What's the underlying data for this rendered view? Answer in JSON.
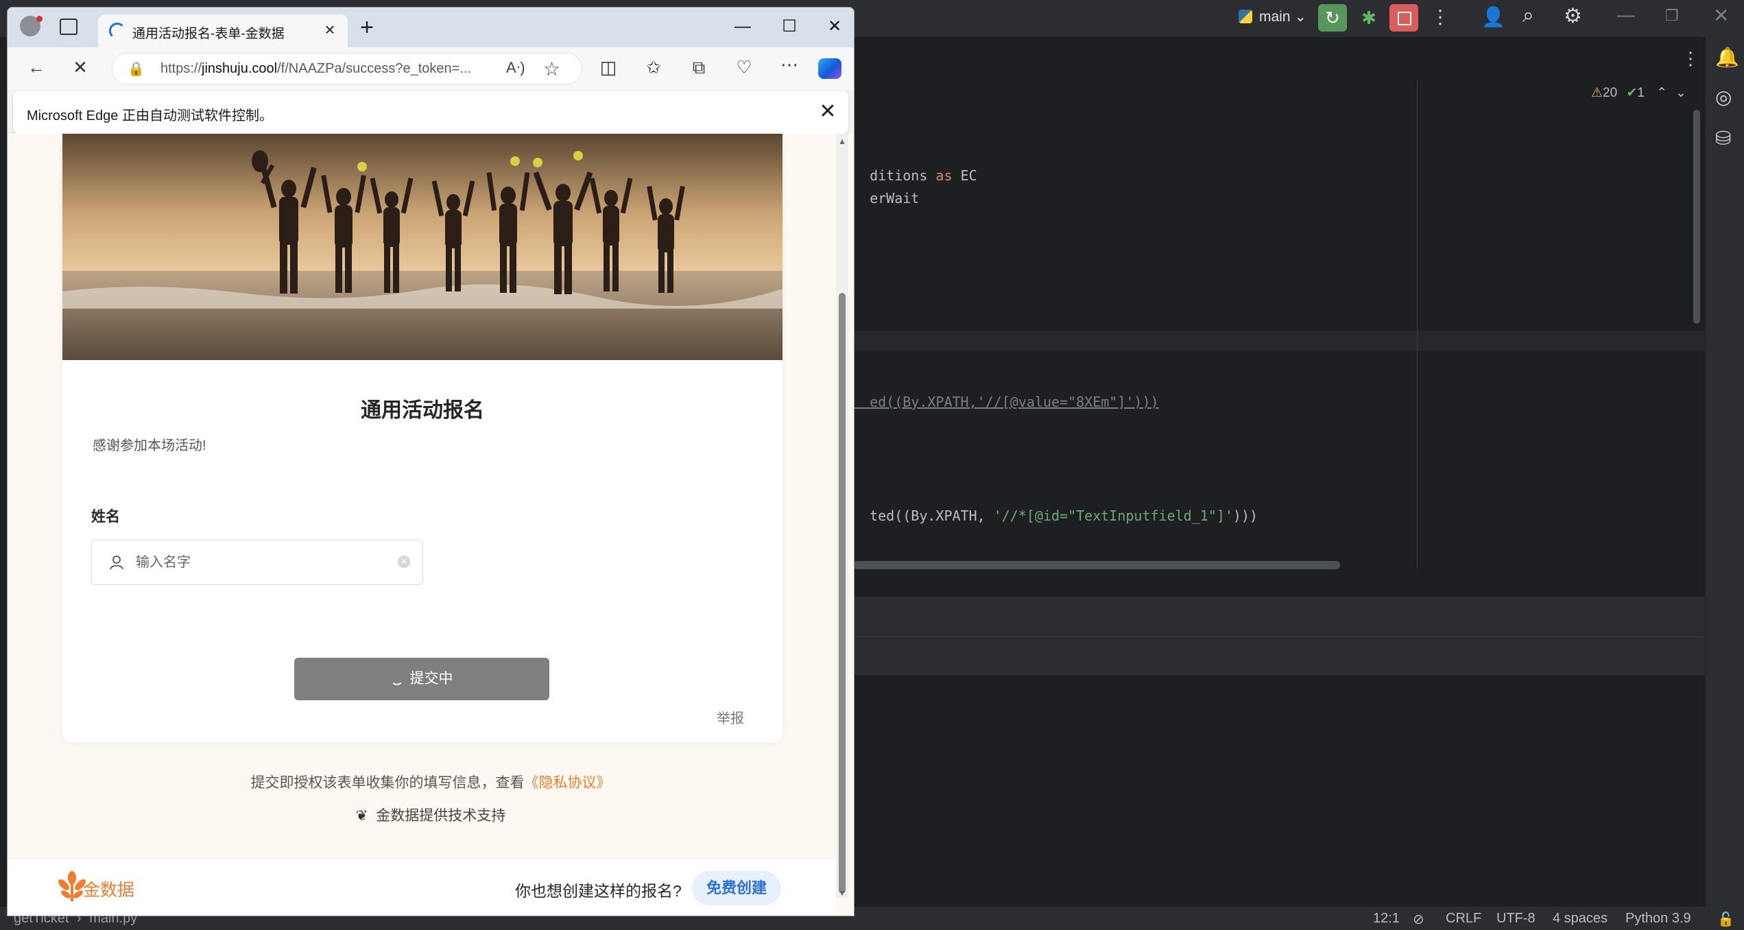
{
  "ide": {
    "branch_label": "main",
    "problems_warning_count": "20",
    "problems_ok_count": "1",
    "code_lines": [
      {
        "plain": "ditions ",
        "kw": "as",
        "rest": " EC"
      },
      {
        "plain": "erWait"
      }
    ],
    "code_line_3": {
      "prefix": "ed((By.XPATH,",
      "string": "'//[@value=\"8XEm\"]'",
      "suffix": ")))"
    },
    "code_line_4": {
      "prefix": "ted((By.XPATH, ",
      "string": "'//*[@id=\"TextInputfield_1\"]'",
      "suffix": ")))"
    },
    "breadcrumb": {
      "project": "getTicket",
      "file": "main.py"
    },
    "status": {
      "position": "12:1",
      "line_sep": "CRLF",
      "encoding": "UTF-8",
      "indent": "4 spaces",
      "interpreter": "Python 3.9"
    }
  },
  "browser": {
    "tab_title": "通用活动报名-表单-金数据",
    "url_domain": "jinshuju.cool",
    "url_prefix": "https://",
    "url_path": "/f/NAAZPa/success?e_token=...",
    "infobar_text": "Microsoft Edge 正由自动测试软件控制。"
  },
  "form": {
    "title": "通用活动报名",
    "description": "感谢参加本场活动!",
    "name_label": "姓名",
    "name_placeholder": "输入名字",
    "submit_label": "提交中",
    "report_label": "举报",
    "consent_text": "提交即授权该表单收集你的填写信息，查看",
    "privacy_link": "《隐私协议》",
    "powered_by": "金数据提供技术支持"
  },
  "footer": {
    "brand": "金数据",
    "question": "你也想创建这样的报名?",
    "create_label": "免费创建"
  },
  "colors": {
    "accent_orange": "#ef7d2d",
    "link_blue": "#2b6fe0",
    "submit_grey": "#7f7f7f",
    "ide_bg": "#1e1f22"
  }
}
